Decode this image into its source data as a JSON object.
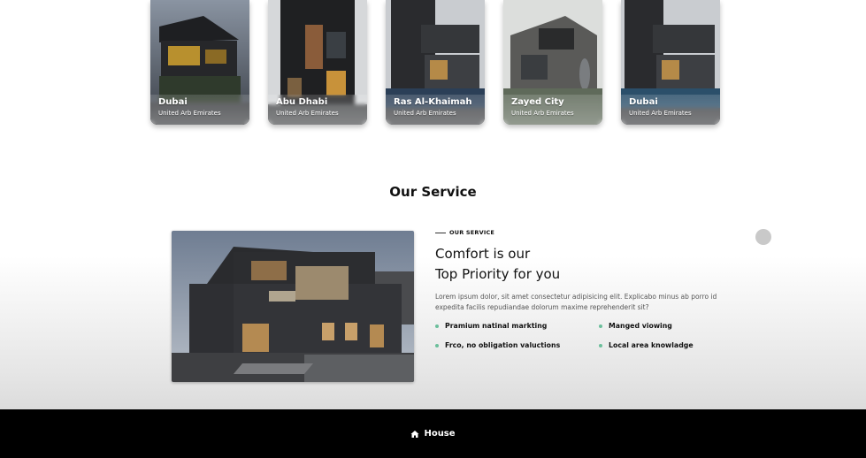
{
  "destinations": [
    {
      "city": "Dubai",
      "country": "United Arb Emirates"
    },
    {
      "city": "Abu Dhabi",
      "country": "United Arb Emirates"
    },
    {
      "city": "Ras Al-Khaimah",
      "country": "United Arb Emirates"
    },
    {
      "city": "Zayed City",
      "country": "United Arb Emirates"
    },
    {
      "city": "Dubai",
      "country": "United Arb Emirates"
    }
  ],
  "service": {
    "section_title": "Our Service",
    "eyebrow": "OUR SERVICE",
    "heading_line1": "Comfort is our",
    "heading_line2": "Top Priority for you",
    "description": "Lorem ipsum dolor, sit amet consectetur adipisicing elit. Explicabo minus ab porro id expedita facilis repudiandae dolorum maxime reprehenderit sit?",
    "features": [
      "Pramium natinal markting",
      "Manged viowing",
      "Frco, no obligation valuctions",
      "Local area knowladge"
    ]
  },
  "footer": {
    "brand": "House",
    "icon": "house-icon"
  },
  "colors": {
    "accent_dot": "#6bbf9b",
    "footer_bg": "#000000"
  }
}
